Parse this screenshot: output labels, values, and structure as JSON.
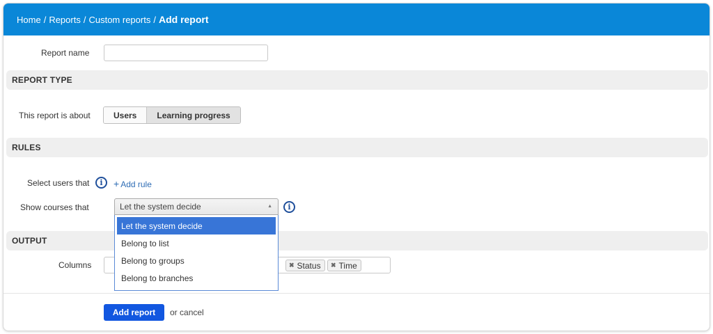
{
  "breadcrumb": {
    "home": "Home",
    "reports": "Reports",
    "custom_reports": "Custom reports",
    "current": "Add report",
    "separator": "/"
  },
  "form": {
    "report_name_label": "Report name",
    "report_name_value": ""
  },
  "sections": {
    "report_type": "REPORT TYPE",
    "rules": "RULES",
    "output": "OUTPUT"
  },
  "report_type": {
    "label": "This report is about",
    "options": [
      "Users",
      "Learning progress"
    ],
    "selected": "Learning progress"
  },
  "rules": {
    "select_users_label": "Select users that",
    "add_rule": "Add rule",
    "show_courses_label": "Show courses that",
    "show_courses_value": "Let the system decide",
    "dropdown_options": [
      "Let the system decide",
      "Belong to list",
      "Belong to groups",
      "Belong to branches"
    ]
  },
  "output": {
    "columns_label": "Columns",
    "visible_tags": [
      "Status",
      "Time"
    ]
  },
  "actions": {
    "submit": "Add report",
    "cancel_prefix": "or",
    "cancel": "cancel"
  },
  "colors": {
    "header": "#0a87d8",
    "primary_button": "#1257e0",
    "dropdown_highlight": "#3875d7",
    "info_icon": "#1f4f9b",
    "link": "#2f6db5"
  },
  "icons": [
    "info-icon",
    "plus-icon",
    "select-arrow-icon",
    "remove-tag-icon"
  ]
}
